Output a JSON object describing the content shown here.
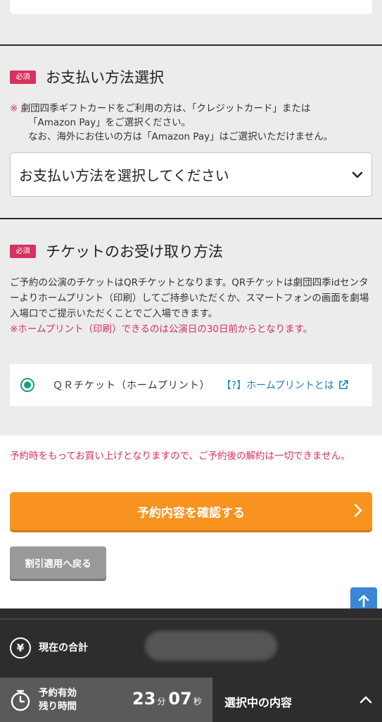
{
  "payment": {
    "required_badge": "必須",
    "title": "お支払い方法選択",
    "note_mark": "※",
    "note_line1": "劇団四季ギフトカードをご利用の方は、「クレジットカード」または",
    "note_line2": "「Amazon Pay」をご選択ください。",
    "note_line3": "なお、海外にお住いの方は「Amazon Pay」はご選択いただけません。",
    "select_placeholder": "お支払い方法を選択してください"
  },
  "ticket": {
    "required_badge": "必須",
    "title": "チケットのお受け取り方法",
    "description": "ご予約の公演のチケットはQRチケットとなります。QRチケットは劇団四季idセンターよりホームプリント（印刷）してご持参いただくか、スマートフォンの画面を劇場入場口でご提示いただくことでご入場できます。",
    "notice": "※ホームプリント（印刷）できるのは公演日の30日前からとなります。",
    "option_label": "ＱＲチケット（ホームプリント）",
    "help_link": "【?】ホームプリントとは"
  },
  "confirm": {
    "warning": "予約時をもってお買い上げとなりますので、ご予約後の解約は一切できません。",
    "primary_button": "予約内容を確認する",
    "back_button": "割引適用へ戻る"
  },
  "footer": {
    "total_label": "現在の合計",
    "yen_symbol": "¥",
    "timer_label_1": "予約有効",
    "timer_label_2": "残り時間",
    "minutes": "23",
    "minutes_unit": "分",
    "seconds": "07",
    "seconds_unit": "秒",
    "selection_label": "選択中の内容"
  },
  "colors": {
    "accent_orange": "#f7931e",
    "required_red": "#d6325e",
    "link_blue": "#1e7cc8",
    "radio_green": "#1a9f83"
  }
}
